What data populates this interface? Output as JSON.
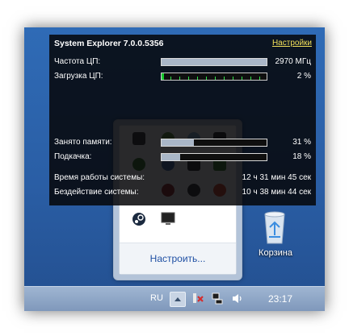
{
  "widget": {
    "title": "System Explorer  7.0.0.5356",
    "settings_link": "Настройки",
    "cpu_freq": {
      "label": "Частота ЦП:",
      "value": "2970 МГц",
      "level": 1.0
    },
    "cpu_load": {
      "label": "Загрузка ЦП:",
      "value": "2 %",
      "level": 0.02
    },
    "memory": {
      "label": "Занято памяти:",
      "value": "31 %",
      "level": 0.31
    },
    "swap": {
      "label": "Подкачка:",
      "value": "18 %",
      "level": 0.18
    },
    "uptime": {
      "label": "Время работы системы:",
      "value": "12 ч 31 мин 45 сек"
    },
    "idle": {
      "label": "Бездействие системы:",
      "value": "10 ч 38 мин 44 сек"
    }
  },
  "flyout": {
    "customize_label": "Настроить..."
  },
  "desktop": {
    "recycle_bin_label": "Корзина"
  },
  "taskbar": {
    "language": "RU",
    "clock": "23:17"
  }
}
